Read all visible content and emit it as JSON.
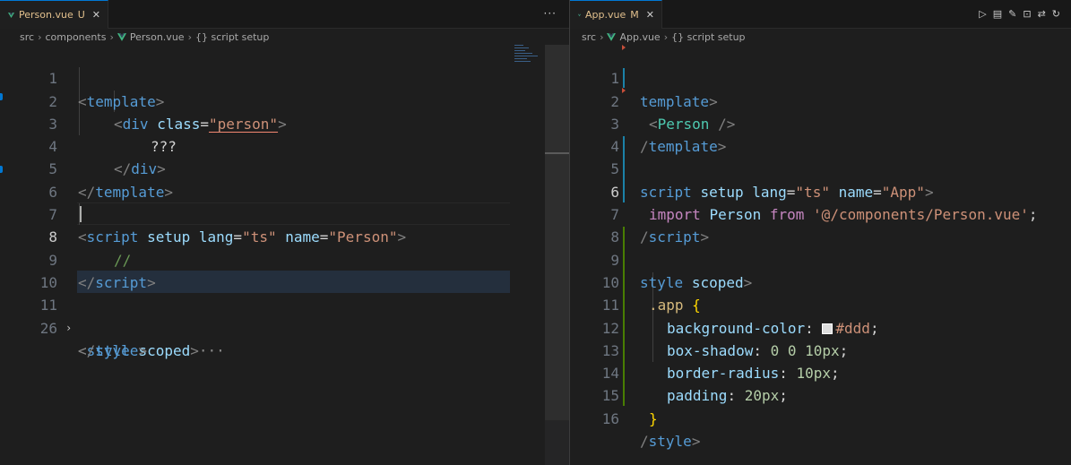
{
  "left": {
    "tab": {
      "name": "Person.vue",
      "state": "U"
    },
    "more_label": "···",
    "breadcrumb": {
      "p1": "src",
      "p2": "components",
      "file": "Person.vue",
      "symbol": "{} script setup"
    },
    "line_numbers": [
      "1",
      "2",
      "3",
      "4",
      "5",
      "6",
      "7",
      "8",
      "9",
      "10",
      "11",
      "26"
    ],
    "code": {
      "l1": {
        "a": "<",
        "b": "template",
        "c": ">"
      },
      "l2": {
        "a": "<",
        "b": "div",
        "c": "class",
        "d": "=",
        "e": "\"person\"",
        "f": ">"
      },
      "l3": {
        "a": "???"
      },
      "l4": {
        "a": "</",
        "b": "div",
        "c": ">"
      },
      "l5": {
        "a": "</",
        "b": "template",
        "c": ">"
      },
      "l7": {
        "a": "<",
        "b": "script",
        "c": "setup",
        "d": "lang",
        "e": "=",
        "f": "\"ts\"",
        "g": "name",
        "h": "=",
        "i": "\"Person\"",
        "j": ">"
      },
      "l8": {
        "a": "//"
      },
      "l9": {
        "a": "</",
        "b": "script",
        "c": ">"
      },
      "l11": {
        "a": "<",
        "b": "style",
        "c": "scoped",
        "d": ">",
        "e": "···"
      },
      "l26": {
        "a": "</",
        "b": "style",
        "c": ">"
      }
    }
  },
  "right": {
    "tab": {
      "name": "App.vue",
      "state": "M"
    },
    "breadcrumb": {
      "p1": "src",
      "file": "App.vue",
      "symbol": "{} script setup"
    },
    "line_numbers": [
      "1",
      "2",
      "3",
      "4",
      "5",
      "6",
      "7",
      "8",
      "9",
      "10",
      "11",
      "12",
      "13",
      "14",
      "15",
      "16"
    ],
    "code": {
      "l1": {
        "a": "template",
        "b": ">"
      },
      "l2": {
        "a": "<",
        "b": "Person",
        "c": "/>"
      },
      "l3": {
        "a": "/",
        "b": "template",
        "c": ">"
      },
      "l5": {
        "a": "script",
        "b": "setup",
        "c": "lang",
        "d": "=",
        "e": "\"ts\"",
        "f": "name",
        "g": "=",
        "h": "\"App\"",
        "i": ">"
      },
      "l6": {
        "a": "import",
        "b": "Person",
        "c": "from",
        "d": "'@/components/Person.vue'",
        "e": ";"
      },
      "l7": {
        "a": "/",
        "b": "script",
        "c": ">"
      },
      "l9": {
        "a": "style",
        "b": "scoped",
        "c": ">"
      },
      "l10": {
        "a": ".app",
        "b": "{"
      },
      "l11": {
        "a": "background-color",
        "b": ":",
        "c": "#ddd",
        "d": ";"
      },
      "l12": {
        "a": "box-shadow",
        "b": ":",
        "c": "0 0 10px",
        "d": ";"
      },
      "l13": {
        "a": "border-radius",
        "b": ":",
        "c": "10px",
        "d": ";"
      },
      "l14": {
        "a": "padding",
        "b": ":",
        "c": "20px",
        "d": ";"
      },
      "l15": {
        "a": "}"
      },
      "l16": {
        "a": "/",
        "b": "style",
        "c": ">"
      }
    }
  },
  "colors": {
    "vue_green": "#41b883",
    "untracked": "#e2c08d",
    "accent": "#0078d4",
    "swatch": "#dddddd"
  },
  "icons": {
    "run": "run-icon",
    "preview": "open-preview-icon",
    "edit": "edit-icon",
    "diff": "compare-icon",
    "git": "git-compare-icon",
    "sync": "refresh-icon"
  }
}
